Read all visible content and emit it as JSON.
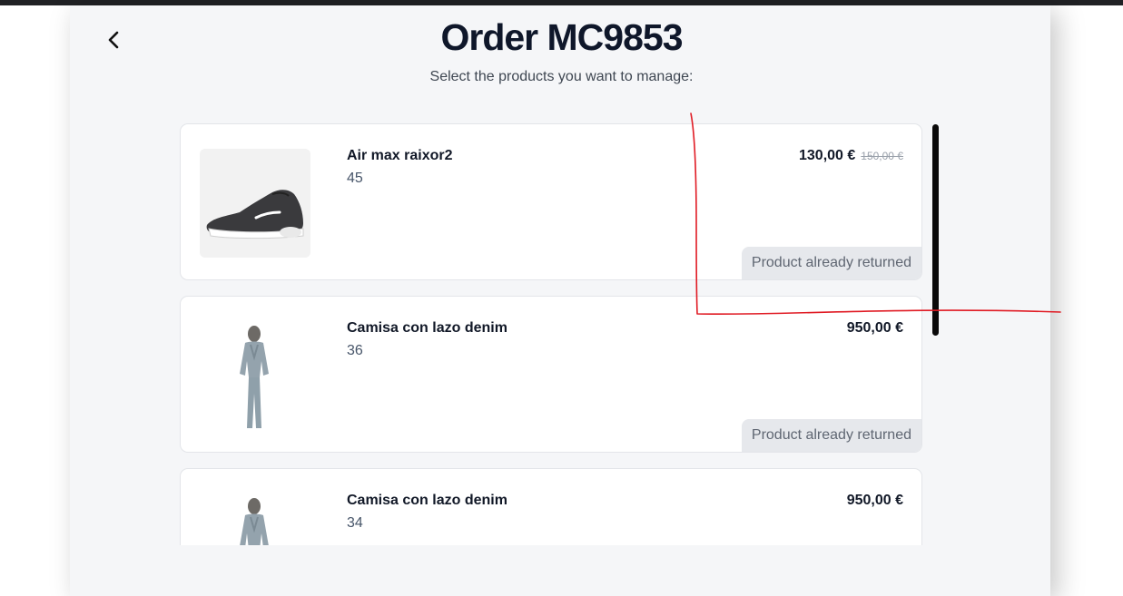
{
  "header": {
    "title": "Order MC9853",
    "subtitle": "Select the products you want to manage:",
    "back_icon": "chevron-left-icon"
  },
  "products": [
    {
      "name": "Air max raixor2",
      "size": "45",
      "price": "130,00 €",
      "old_price": "150,00 €",
      "status": "Product already returned",
      "image": "sneaker-image"
    },
    {
      "name": "Camisa con lazo denim",
      "size": "36",
      "price": "950,00 €",
      "status": "Product already returned",
      "image": "denim-outfit-image"
    },
    {
      "name": "Camisa con lazo denim",
      "size": "34",
      "price": "950,00 €",
      "image": "denim-outfit-image"
    }
  ],
  "colors": {
    "panel_background": "#f5f6f8",
    "card_background": "#ffffff",
    "badge_background": "#e6e8ec",
    "title_color": "#0f172a",
    "annotation_red": "#e01b24",
    "scrollbar": "#0a0a0a"
  }
}
